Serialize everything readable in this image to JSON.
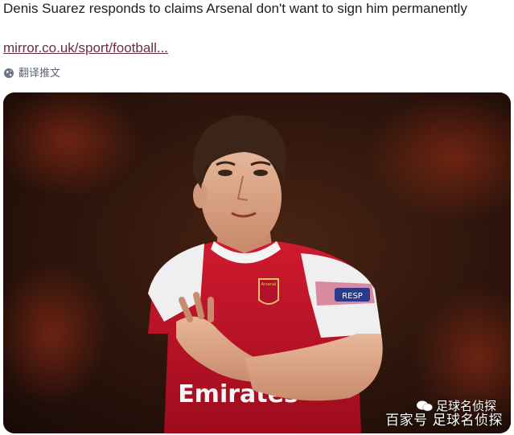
{
  "tweet": {
    "headline": "Denis Suarez responds to claims Arsenal don't want to sign him permanently",
    "link_text": "mirror.co.uk/sport/football...",
    "translate_label": "翻译推文",
    "translate_icon": "globe-icon"
  },
  "media": {
    "alt_subject": "footballer-photo",
    "shirt_sponsor": "Emirates",
    "sleeve_badge": "RESP",
    "crest_text": "Arsenal",
    "colors": {
      "shirt_red": "#c8102e",
      "sleeve_white": "#f2f2f2",
      "background": "#3a1a10"
    }
  },
  "watermark": {
    "source": "足球名侦探",
    "platform_line": "百家号 足球名侦探",
    "icon": "wechat-icon"
  }
}
